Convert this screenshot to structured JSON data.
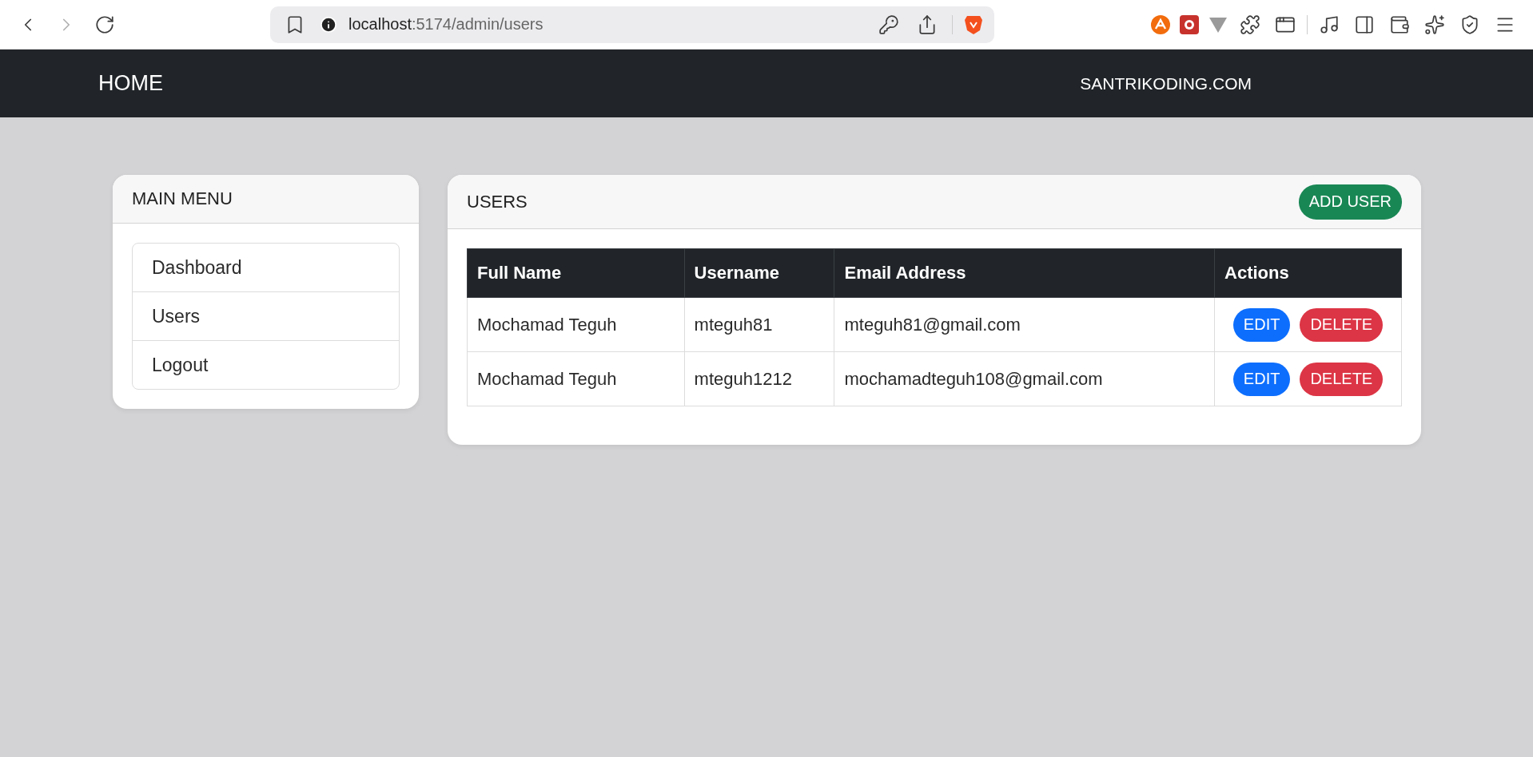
{
  "browser": {
    "address": {
      "host": "localhost",
      "path": ":5174/admin/users"
    }
  },
  "navbar": {
    "brand": "HOME",
    "right_link": "SANTRIKODING.COM"
  },
  "sidebar": {
    "title": "MAIN MENU",
    "items": [
      {
        "label": "Dashboard"
      },
      {
        "label": "Users"
      },
      {
        "label": "Logout"
      }
    ]
  },
  "users_card": {
    "title": "USERS",
    "add_button": "ADD USER",
    "table": {
      "columns": [
        "Full Name",
        "Username",
        "Email Address",
        "Actions"
      ],
      "rows": [
        {
          "full_name": "Mochamad Teguh",
          "username": "mteguh81",
          "email": "mteguh81@gmail.com",
          "actions": [
            "EDIT",
            "DELETE"
          ]
        },
        {
          "full_name": "Mochamad Teguh",
          "username": "mteguh1212",
          "email": "mochamadteguh108@gmail.com",
          "actions": [
            "EDIT",
            "DELETE"
          ]
        }
      ]
    }
  }
}
